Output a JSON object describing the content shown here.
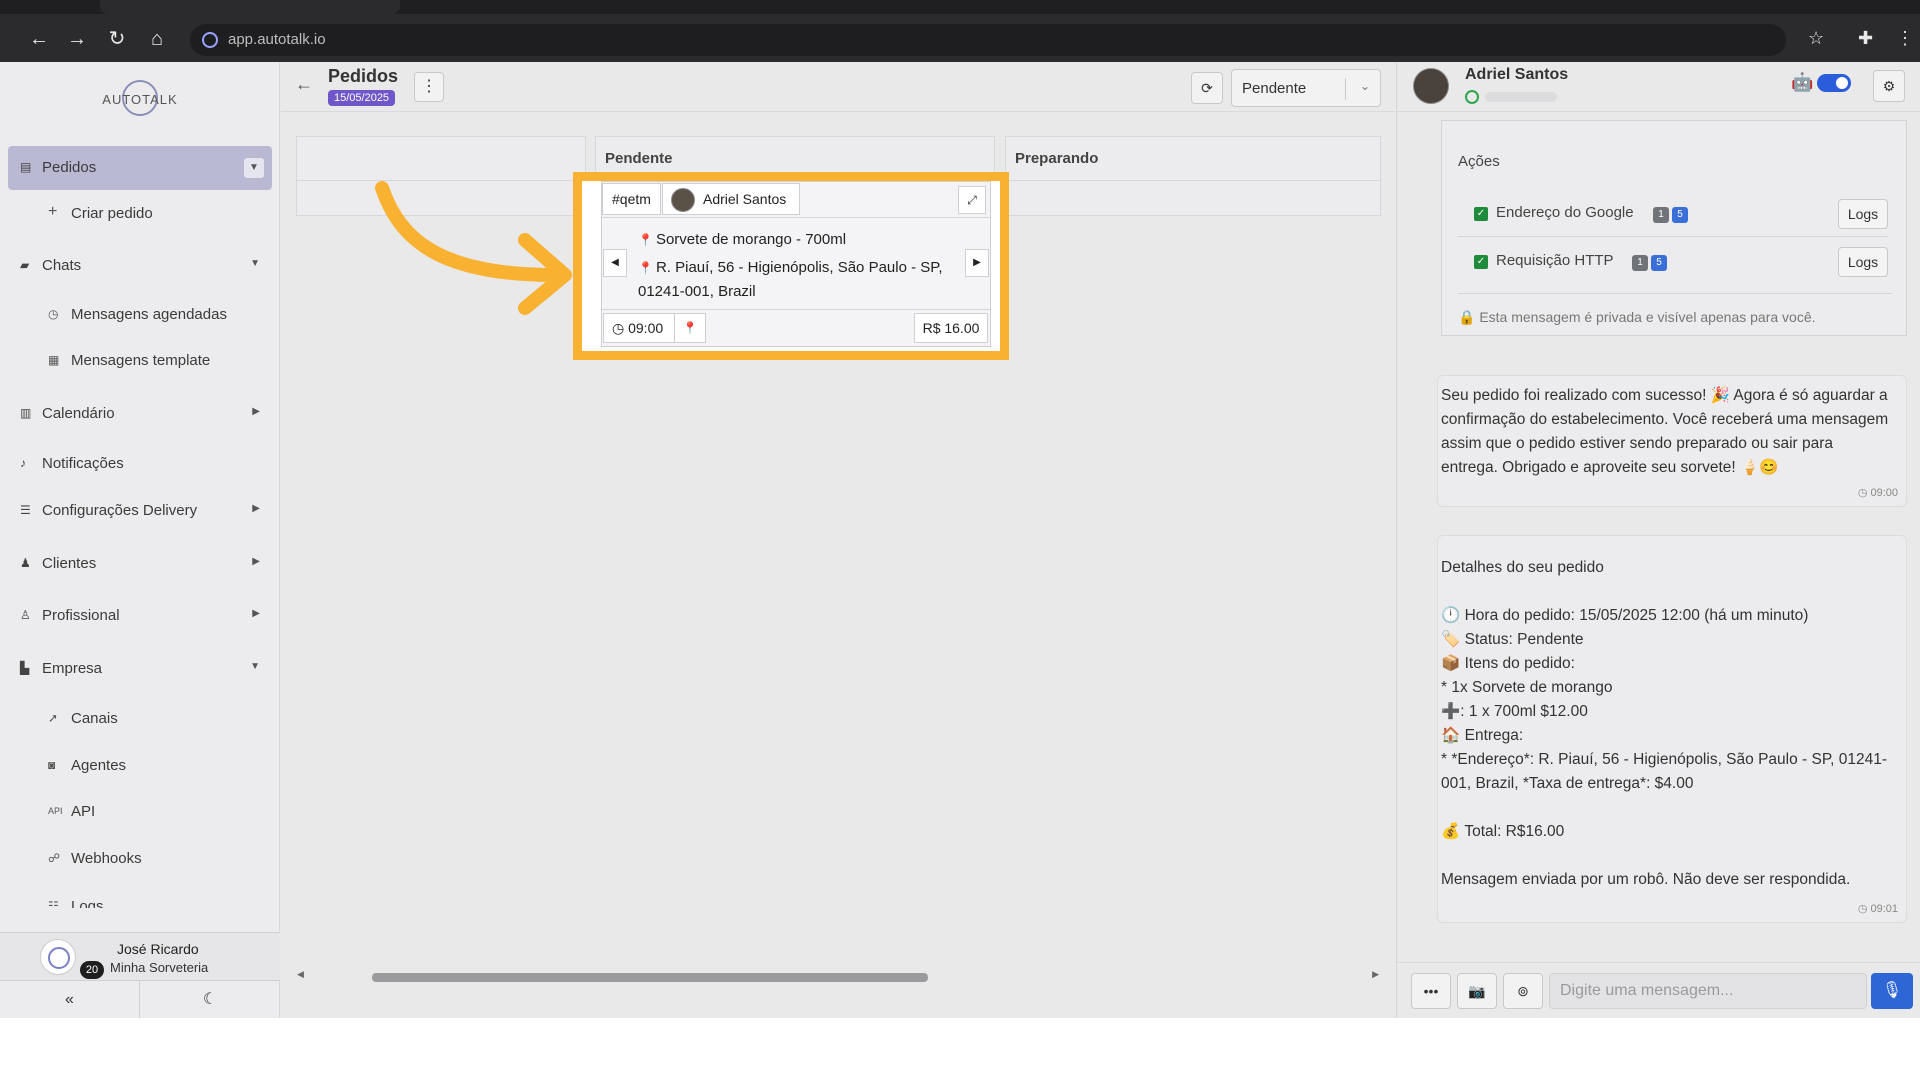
{
  "browser": {
    "url": "app.autotalk.io"
  },
  "sidebar": {
    "logo_text": "AUTOTALK",
    "items": [
      {
        "label": "Pedidos",
        "icon": "clipboard-icon"
      },
      {
        "label": "Criar pedido",
        "icon": "plus-icon"
      },
      {
        "label": "Chats",
        "icon": "chat-icon"
      },
      {
        "label": "Mensagens agendadas",
        "icon": "clock-icon"
      },
      {
        "label": "Mensagens template",
        "icon": "template-icon"
      },
      {
        "label": "Calendário",
        "icon": "calendar-icon"
      },
      {
        "label": "Notificações",
        "icon": "bell-icon"
      },
      {
        "label": "Configurações Delivery",
        "icon": "sliders-icon"
      },
      {
        "label": "Clientes",
        "icon": "users-icon"
      },
      {
        "label": "Profissional",
        "icon": "user-gear-icon"
      },
      {
        "label": "Empresa",
        "icon": "building-icon"
      },
      {
        "label": "Canais",
        "icon": "rocket-icon"
      },
      {
        "label": "Agentes",
        "icon": "robot-icon"
      },
      {
        "label": "API",
        "icon": "api-icon"
      },
      {
        "label": "Webhooks",
        "icon": "webhook-icon"
      },
      {
        "label": "Logs",
        "icon": "list-icon"
      }
    ],
    "user": {
      "name": "José Ricardo",
      "org": "Minha Sorveteria",
      "badge": "20"
    }
  },
  "main": {
    "title": "Pedidos",
    "date": "15/05/2025",
    "status_filter": "Pendente",
    "columns": [
      {
        "title": ""
      },
      {
        "title": "Pendente"
      },
      {
        "title": "Preparando"
      }
    ],
    "card": {
      "code": "#qetm",
      "customer": "Adriel Santos",
      "item": "Sorvete de morango - 700ml",
      "address": "R. Piauí, 56 - Higienópolis, São Paulo - SP, 01241-001, Brazil",
      "time": "09:00",
      "price": "R$ 16.00"
    }
  },
  "chat": {
    "contact_name": "Adriel Santos",
    "actions": {
      "title": "Ações",
      "items": [
        {
          "label": "Endereço do Google",
          "pill1": "1",
          "pill2": "5",
          "button": "Logs"
        },
        {
          "label": "Requisição HTTP",
          "pill1": "1",
          "pill2": "5",
          "button": "Logs"
        }
      ],
      "private_note": "🔒 Esta mensagem é privada e visível apenas para você."
    },
    "messages": [
      {
        "text": "Seu pedido foi realizado com sucesso! 🎉 Agora é só aguardar a confirmação do estabelecimento. Você receberá uma mensagem assim que o pedido estiver sendo preparado ou sair para entrega. Obrigado e aproveite seu sorvete! 🍦😊",
        "time": "09:00"
      },
      {
        "text": "Detalhes do seu pedido\n\n🕛 Hora do pedido: 15/05/2025 12:00 (há um minuto)\n🏷️ Status: Pendente\n📦 Itens do pedido:\n* 1x Sorvete de morango\n➕: 1 x 700ml $12.00\n🏠 Entrega:\n* *Endereço*: R. Piauí, 56 - Higienópolis, São Paulo - SP, 01241-001, Brazil, *Taxa de entrega*: $4.00\n\n💰 Total: R$16.00\n\nMensagem enviada por um robô. Não deve ser respondida.",
        "time": "09:01"
      }
    ],
    "composer_placeholder": "Digite uma mensagem..."
  }
}
